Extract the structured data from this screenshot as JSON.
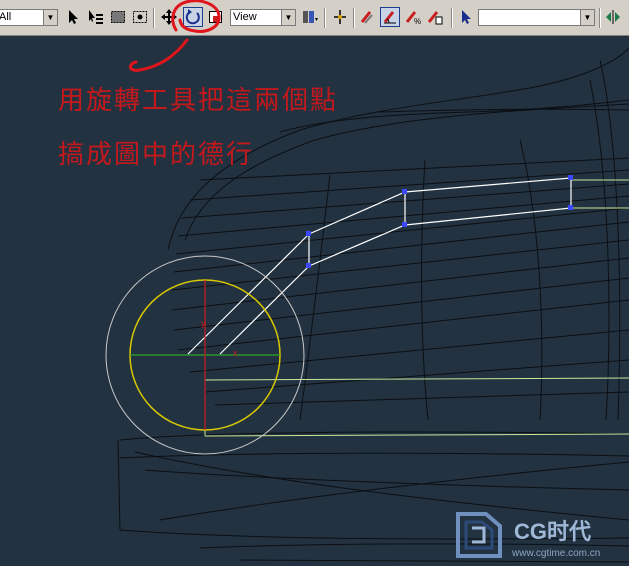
{
  "toolbar": {
    "selection_filter": "All",
    "coord_system": "View",
    "named_selection": "",
    "active_tool": "select-and-rotate"
  },
  "annotation": {
    "line1": "用旋轉工具把這兩個點",
    "line2": "搞成圖中的德行"
  },
  "gizmo": {
    "axis_y": "y",
    "axis_x": "x"
  },
  "watermark": {
    "brand": "CG时代",
    "url": "www.cgtime.com.cn"
  },
  "colors": {
    "toolbar_bg": "#d4d0c8",
    "viewport_bg": "#233240",
    "annotation": "#c3181c",
    "wireframe": "#0b0f14",
    "selected_edge": "#ffffff",
    "vertex": "#3a48ff",
    "gizmo_outer": "#c9c9c9",
    "gizmo_ring": "#d8c800",
    "axis_x": "#2aa82a",
    "axis_y": "#c81e1e",
    "guide_line": "#c7e89a"
  },
  "icons": [
    "select-icon",
    "select-by-name-icon",
    "rect-region-icon",
    "window-crossing-icon",
    "move-icon",
    "rotate-icon",
    "scale-icon",
    "mirror-icon",
    "pivot-icon",
    "snap-icon",
    "angle-snap-icon",
    "percent-snap-icon",
    "spinner-snap-icon",
    "named-selection-icon",
    "mirror-tool-icon"
  ]
}
